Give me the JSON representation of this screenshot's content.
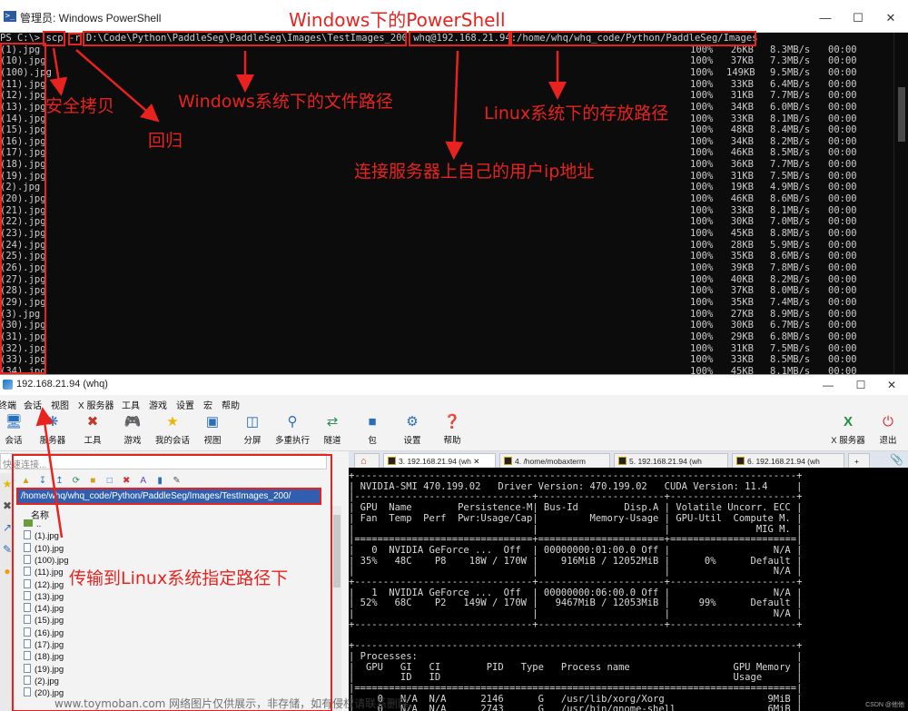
{
  "powershell": {
    "title": "管理员: Windows PowerShell",
    "prompt": "PS C:\\>",
    "command_parts": [
      "scp",
      "-r",
      "D:\\Code\\Python\\PaddleSeg\\PaddleSeg\\Images\\TestImages_200",
      "whq@192.168.21.94",
      ":/home/whq/whq_code/Python/PaddleSeg/Images"
    ],
    "files": [
      {
        "name": "(1).jpg",
        "pct": "100%",
        "size": "26KB",
        "speed": "8.3MB/s",
        "time": "00:00"
      },
      {
        "name": "(10).jpg",
        "pct": "100%",
        "size": "37KB",
        "speed": "7.3MB/s",
        "time": "00:00"
      },
      {
        "name": "(100).jpg",
        "pct": "100%",
        "size": "149KB",
        "speed": "9.5MB/s",
        "time": "00:00"
      },
      {
        "name": "(11).jpg",
        "pct": "100%",
        "size": "33KB",
        "speed": "6.4MB/s",
        "time": "00:00"
      },
      {
        "name": "(12).jpg",
        "pct": "100%",
        "size": "31KB",
        "speed": "7.7MB/s",
        "time": "00:00"
      },
      {
        "name": "(13).jpg",
        "pct": "100%",
        "size": "34KB",
        "speed": "6.0MB/s",
        "time": "00:00"
      },
      {
        "name": "(14).jpg",
        "pct": "100%",
        "size": "33KB",
        "speed": "8.1MB/s",
        "time": "00:00"
      },
      {
        "name": "(15).jpg",
        "pct": "100%",
        "size": "48KB",
        "speed": "8.4MB/s",
        "time": "00:00"
      },
      {
        "name": "(16).jpg",
        "pct": "100%",
        "size": "34KB",
        "speed": "8.2MB/s",
        "time": "00:00"
      },
      {
        "name": "(17).jpg",
        "pct": "100%",
        "size": "46KB",
        "speed": "8.5MB/s",
        "time": "00:00"
      },
      {
        "name": "(18).jpg",
        "pct": "100%",
        "size": "36KB",
        "speed": "7.7MB/s",
        "time": "00:00"
      },
      {
        "name": "(19).jpg",
        "pct": "100%",
        "size": "31KB",
        "speed": "7.5MB/s",
        "time": "00:00"
      },
      {
        "name": "(2).jpg",
        "pct": "100%",
        "size": "19KB",
        "speed": "4.9MB/s",
        "time": "00:00"
      },
      {
        "name": "(20).jpg",
        "pct": "100%",
        "size": "46KB",
        "speed": "8.6MB/s",
        "time": "00:00"
      },
      {
        "name": "(21).jpg",
        "pct": "100%",
        "size": "33KB",
        "speed": "8.1MB/s",
        "time": "00:00"
      },
      {
        "name": "(22).jpg",
        "pct": "100%",
        "size": "30KB",
        "speed": "7.0MB/s",
        "time": "00:00"
      },
      {
        "name": "(23).jpg",
        "pct": "100%",
        "size": "45KB",
        "speed": "8.8MB/s",
        "time": "00:00"
      },
      {
        "name": "(24).jpg",
        "pct": "100%",
        "size": "28KB",
        "speed": "5.9MB/s",
        "time": "00:00"
      },
      {
        "name": "(25).jpg",
        "pct": "100%",
        "size": "35KB",
        "speed": "8.6MB/s",
        "time": "00:00"
      },
      {
        "name": "(26).jpg",
        "pct": "100%",
        "size": "39KB",
        "speed": "7.8MB/s",
        "time": "00:00"
      },
      {
        "name": "(27).jpg",
        "pct": "100%",
        "size": "40KB",
        "speed": "8.2MB/s",
        "time": "00:00"
      },
      {
        "name": "(28).jpg",
        "pct": "100%",
        "size": "37KB",
        "speed": "8.0MB/s",
        "time": "00:00"
      },
      {
        "name": "(29).jpg",
        "pct": "100%",
        "size": "35KB",
        "speed": "7.4MB/s",
        "time": "00:00"
      },
      {
        "name": "(3).jpg",
        "pct": "100%",
        "size": "27KB",
        "speed": "8.9MB/s",
        "time": "00:00"
      },
      {
        "name": "(30).jpg",
        "pct": "100%",
        "size": "30KB",
        "speed": "6.7MB/s",
        "time": "00:00"
      },
      {
        "name": "(31).jpg",
        "pct": "100%",
        "size": "29KB",
        "speed": "6.8MB/s",
        "time": "00:00"
      },
      {
        "name": "(32).jpg",
        "pct": "100%",
        "size": "31KB",
        "speed": "7.5MB/s",
        "time": "00:00"
      },
      {
        "name": "(33).jpg",
        "pct": "100%",
        "size": "33KB",
        "speed": "8.5MB/s",
        "time": "00:00"
      },
      {
        "name": "(34).jpg",
        "pct": "100%",
        "size": "45KB",
        "speed": "8.1MB/s",
        "time": "00:00"
      }
    ]
  },
  "annotations": {
    "title": "Windows下的PowerShell",
    "scp": "安全拷贝",
    "recursive": "回归",
    "win_path": "Windows系统下的文件路径",
    "linux_path": "Linux系统下的存放路径",
    "user_ip": "连接服务器上自己的用户ip地址",
    "transfer": "传输到Linux系统指定路径下"
  },
  "mobaxterm": {
    "title": "192.168.21.94 (whq)",
    "menu": [
      "终端",
      "会话",
      "视图",
      "X 服务器",
      "工具",
      "游戏",
      "设置",
      "宏",
      "帮助"
    ],
    "toolbar": [
      {
        "label": "会话",
        "icon": "session-icon"
      },
      {
        "label": "服务器",
        "icon": "servers-icon"
      },
      {
        "label": "工具",
        "icon": "tools-icon"
      },
      {
        "label": "游戏",
        "icon": "games-icon"
      },
      {
        "label": "我的会话",
        "icon": "star-icon"
      },
      {
        "label": "视图",
        "icon": "view-icon"
      },
      {
        "label": "分屏",
        "icon": "split-icon"
      },
      {
        "label": "多重执行",
        "icon": "multiexec-icon"
      },
      {
        "label": "隧道",
        "icon": "tunnel-icon"
      },
      {
        "label": "包",
        "icon": "package-icon"
      },
      {
        "label": "设置",
        "icon": "gear-icon"
      },
      {
        "label": "帮助",
        "icon": "help-icon"
      }
    ],
    "toolbar_right": [
      {
        "label": "X 服务器",
        "icon": "x-server-icon"
      },
      {
        "label": "退出",
        "icon": "power-icon"
      }
    ],
    "quick_connect_placeholder": "快速连接...",
    "sftp_path": "/home/whq/whq_code/Python/PaddleSeg/Images/TestImages_200/",
    "name_column": "名称",
    "parent_dir": "..",
    "files": [
      "(1).jpg",
      "(10).jpg",
      "(100).jpg",
      "(11).jpg",
      "(12).jpg",
      "(13).jpg",
      "(14).jpg",
      "(15).jpg",
      "(16).jpg",
      "(17).jpg",
      "(18).jpg",
      "(19).jpg",
      "(2).jpg",
      "(20).jpg"
    ],
    "tabs": [
      "3. 192.168.21.94 (wh",
      "4. /home/mobaxterm",
      "5. 192.168.21.94 (wh",
      "6. 192.168.21.94 (wh"
    ],
    "terminal_lines": [
      "+-----------------------------------------------------------------------------+",
      "| NVIDIA-SMI 470.199.02   Driver Version: 470.199.02   CUDA Version: 11.4     |",
      "|-------------------------------+----------------------+----------------------+",
      "| GPU  Name        Persistence-M| Bus-Id        Disp.A | Volatile Uncorr. ECC |",
      "| Fan  Temp  Perf  Pwr:Usage/Cap|         Memory-Usage | GPU-Util  Compute M. |",
      "|                               |                      |               MIG M. |",
      "|===============================+======================+======================|",
      "|   0  NVIDIA GeForce ...  Off  | 00000000:01:00.0 Off |                  N/A |",
      "| 35%   48C    P8    18W / 170W |    916MiB / 12052MiB |      0%      Default |",
      "|                               |                      |                  N/A |",
      "+-------------------------------+----------------------+----------------------+",
      "|   1  NVIDIA GeForce ...  Off  | 00000000:06:00.0 Off |                  N/A |",
      "| 52%   68C    P2   149W / 170W |   9467MiB / 12053MiB |     99%      Default |",
      "|                               |                      |                  N/A |",
      "+-------------------------------+----------------------+----------------------+",
      "",
      "+-----------------------------------------------------------------------------+",
      "| Processes:                                                                  |",
      "|  GPU   GI   CI        PID   Type   Process name                  GPU Memory |",
      "|        ID   ID                                                   Usage      |",
      "|=============================================================================|",
      "|    0   N/A  N/A      2146      G   /usr/lib/xorg/Xorg                  9MiB |",
      "|    0   N/A  N/A      2743      G   /usr/bin/gnome-shell                6MiB |"
    ]
  },
  "watermark": "www.toymoban.com 网络图片仅供展示，非存储，如有侵权请联系删除。",
  "corner_mark": "CSDN @他他",
  "colors": {
    "annotation": "#e8231f",
    "ps_background": "#0c0c0c",
    "sftp_path_bg": "#2f5fae"
  }
}
